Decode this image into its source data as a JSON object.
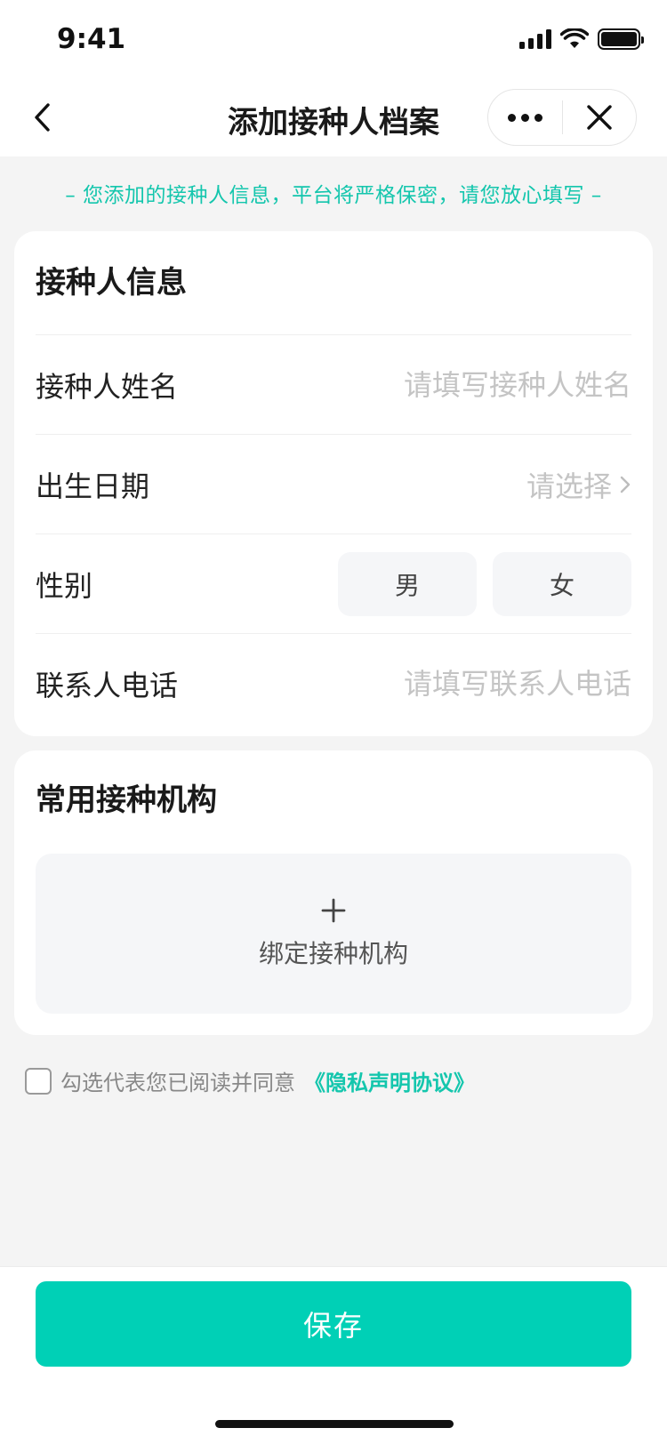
{
  "status_bar": {
    "time": "9:41"
  },
  "nav": {
    "title": "添加接种人档案"
  },
  "notice": "– 您添加的接种人信息，平台将严格保密，请您放心填写 –",
  "info_card": {
    "title": "接种人信息",
    "name": {
      "label": "接种人姓名",
      "placeholder": "请填写接种人姓名"
    },
    "birth": {
      "label": "出生日期",
      "placeholder": "请选择"
    },
    "gender": {
      "label": "性别",
      "options": [
        "男",
        "女"
      ]
    },
    "phone": {
      "label": "联系人电话",
      "placeholder": "请填写联系人电话"
    }
  },
  "org_card": {
    "title": "常用接种机构",
    "bind_label": "绑定接种机构"
  },
  "agreement": {
    "text": "勾选代表您已阅读并同意",
    "link": "《隐私声明协议》"
  },
  "footer": {
    "save_label": "保存"
  },
  "colors": {
    "accent": "#00d0b6",
    "notice_text": "#14c6ad",
    "background": "#f4f4f4"
  }
}
